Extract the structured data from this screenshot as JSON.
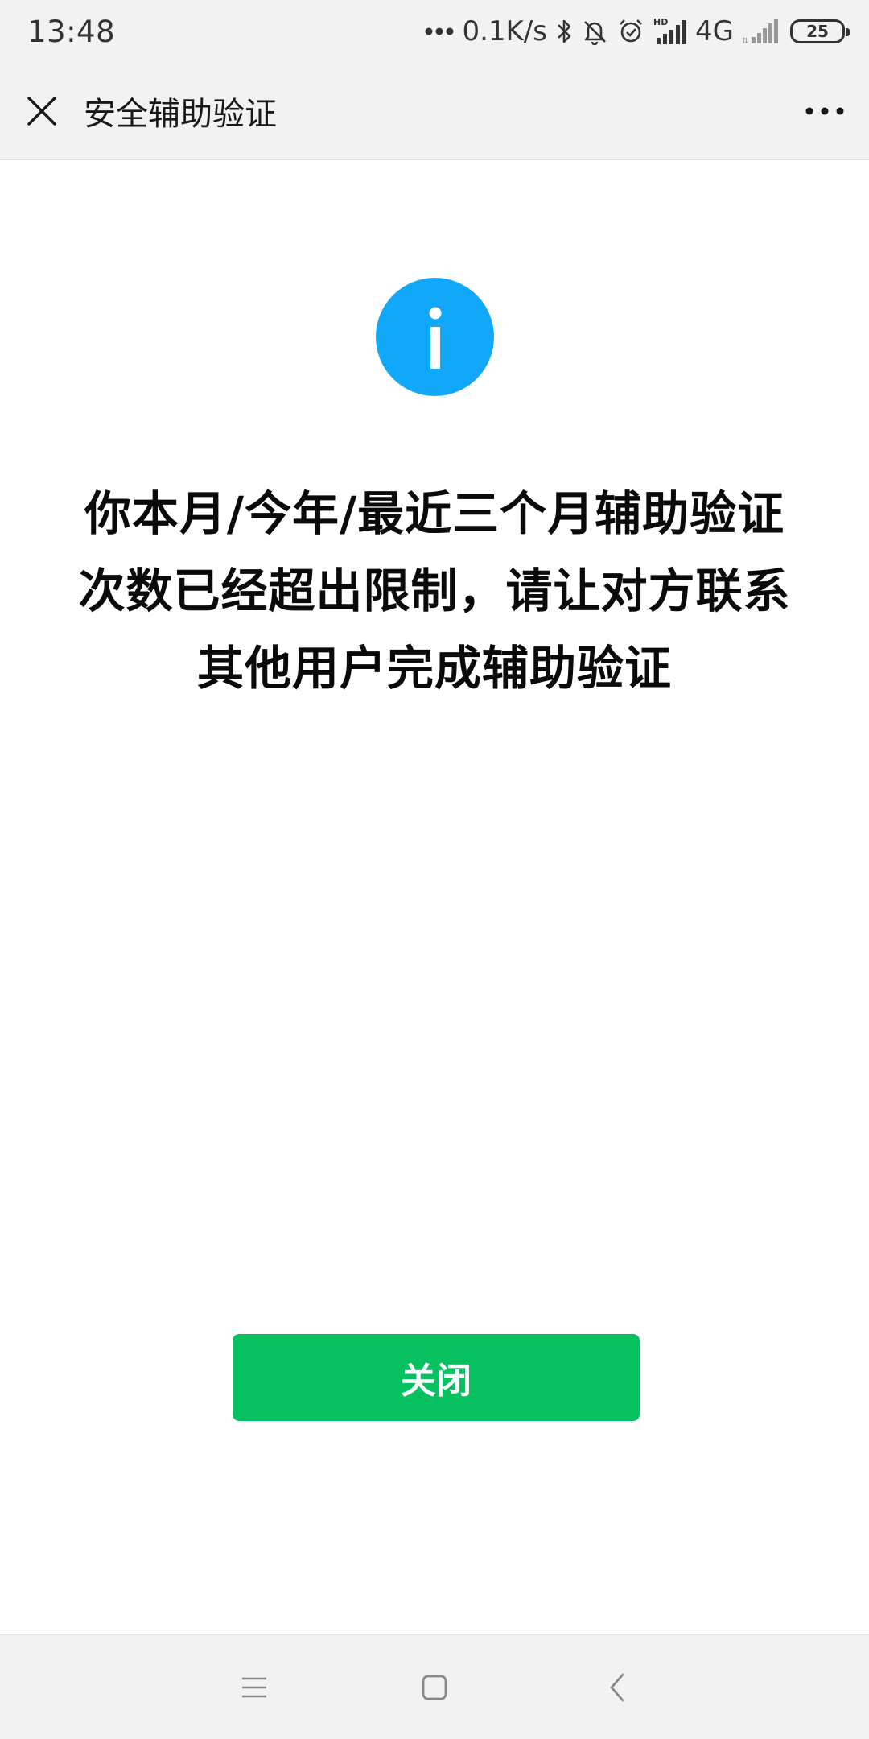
{
  "status_bar": {
    "time": "13:48",
    "net_speed": "0.1K/s",
    "network": "4G",
    "battery_level": "25",
    "icons": [
      "dots-icon",
      "bluetooth-icon",
      "bell-off-icon",
      "alarm-icon",
      "signal-hd-icon",
      "signal-icon"
    ]
  },
  "header": {
    "title": "安全辅助验证",
    "close_icon": "close-icon",
    "more_icon": "more-icon"
  },
  "content": {
    "icon": "info-icon",
    "icon_color": "#12a8fa",
    "message_lines": [
      "你本月/今年/最近三个月辅助验证",
      "次数已经超出限制，请让对方联系",
      "其他用户完成辅助验证"
    ]
  },
  "actions": {
    "close_label": "关闭",
    "close_color": "#07c160"
  },
  "nav": {
    "icons": [
      "menu-icon",
      "home-icon",
      "back-icon"
    ]
  }
}
